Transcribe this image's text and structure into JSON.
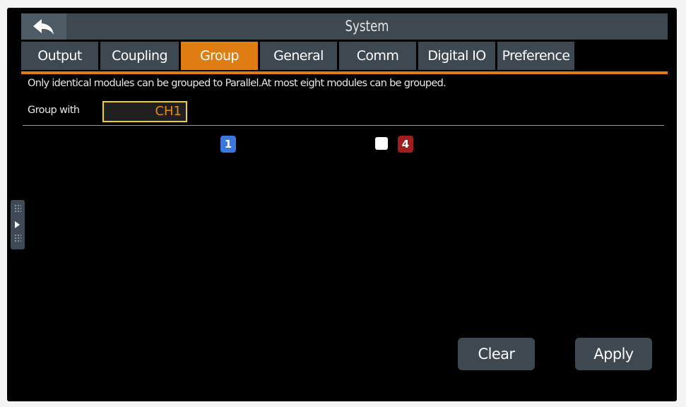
{
  "window": {
    "title": "System"
  },
  "icons": {
    "back": "back-arrow-icon",
    "side_handle": "expand-arrow-icon"
  },
  "tabs": [
    {
      "label": "Output",
      "active": false
    },
    {
      "label": "Coupling",
      "active": false
    },
    {
      "label": "Group",
      "active": true
    },
    {
      "label": "General",
      "active": false
    },
    {
      "label": "Comm",
      "active": false
    },
    {
      "label": "Digital IO",
      "active": false
    },
    {
      "label": "Preference",
      "active": false
    }
  ],
  "group": {
    "info": "Only identical modules can be grouped to Parallel.At most eight modules can be grouped.",
    "label": "Group with",
    "value": "CH1",
    "modules": [
      {
        "number": "1",
        "color": "#3a78e0",
        "checkbox": false
      },
      {
        "number": "4",
        "color": "#a01e1e",
        "checkbox": true,
        "checked": false
      }
    ]
  },
  "buttons": {
    "clear": "Clear",
    "apply": "Apply"
  },
  "colors": {
    "accent": "#df7d12",
    "panel": "#3e4850",
    "field_border": "#f0d21a",
    "field_text": "#e88a18",
    "background": "#000000"
  }
}
